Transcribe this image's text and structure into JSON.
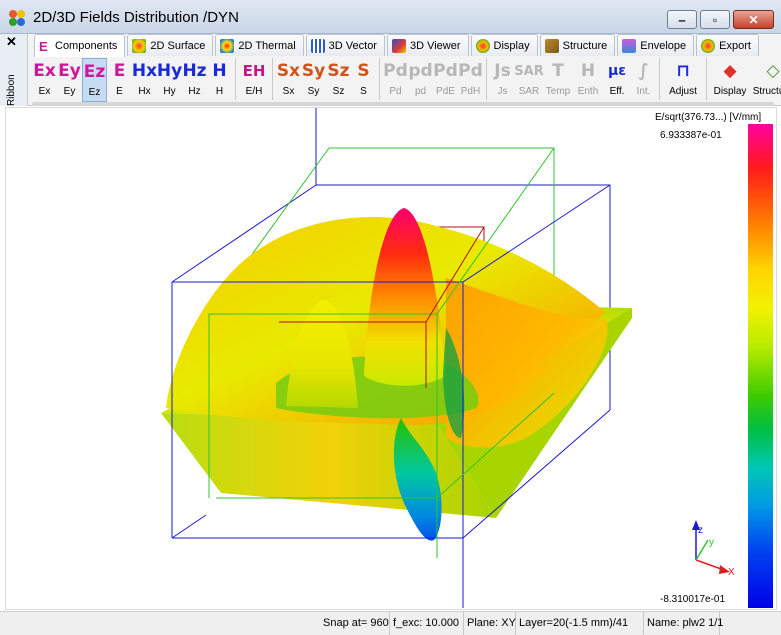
{
  "window": {
    "title": "2D/3D Fields Distribution /DYN"
  },
  "ribbon": {
    "label": "Ribbon",
    "close": "✕"
  },
  "tabs": [
    {
      "label": "Components",
      "icon": "components-icon"
    },
    {
      "label": "2D Surface",
      "icon": "surface-icon"
    },
    {
      "label": "2D Thermal",
      "icon": "thermal-icon"
    },
    {
      "label": "3D Vector",
      "icon": "vector-icon"
    },
    {
      "label": "3D Viewer",
      "icon": "viewer-icon"
    },
    {
      "label": "Display",
      "icon": "display-icon"
    },
    {
      "label": "Structure",
      "icon": "structure-icon"
    },
    {
      "label": "Envelope",
      "icon": "envelope-icon"
    },
    {
      "label": "Export",
      "icon": "export-icon"
    }
  ],
  "tools": [
    {
      "glyph": "Ex",
      "label": "Ex"
    },
    {
      "glyph": "Ey",
      "label": "Ey"
    },
    {
      "glyph": "Ez",
      "label": "Ez"
    },
    {
      "glyph": "E",
      "label": "E"
    },
    {
      "glyph": "Hx",
      "label": "Hx"
    },
    {
      "glyph": "Hy",
      "label": "Hy"
    },
    {
      "glyph": "Hz",
      "label": "Hz"
    },
    {
      "glyph": "H",
      "label": "H"
    },
    {
      "glyph": "EH",
      "label": "E/H"
    },
    {
      "glyph": "Sx",
      "label": "Sx"
    },
    {
      "glyph": "Sy",
      "label": "Sy"
    },
    {
      "glyph": "Sz",
      "label": "Sz"
    },
    {
      "glyph": "S",
      "label": "S"
    },
    {
      "glyph": "Pd",
      "label": "Pd"
    },
    {
      "glyph": "pd",
      "label": "pd"
    },
    {
      "glyph": "Pd",
      "label": "PdE"
    },
    {
      "glyph": "Pd",
      "label": "PdH"
    },
    {
      "glyph": "Js",
      "label": "Js"
    },
    {
      "glyph": "SAR",
      "label": "SAR"
    },
    {
      "glyph": "T",
      "label": "Temp"
    },
    {
      "glyph": "H",
      "label": "Enth"
    },
    {
      "glyph": "με",
      "label": "Eff."
    },
    {
      "glyph": "∫",
      "label": "Int."
    },
    {
      "glyph": "⊓",
      "label": "Adjust"
    },
    {
      "glyph": "◆",
      "label": "Display"
    },
    {
      "glyph": "◇",
      "label": "Structure"
    }
  ],
  "selected_tool": "Ez",
  "colorbar": {
    "title": "E/sqrt(376.73...) [V/mm]",
    "max": "6.933387e-01",
    "min": "-8.310017e-01"
  },
  "axes_triad": {
    "x": "X",
    "y": "y",
    "z": "z"
  },
  "status": {
    "snap": "Snap at= 960",
    "fexc": "f_exc: 10.000",
    "plane": "Plane: XY",
    "layer": "Layer=20(-1.5 mm)/41",
    "name": "Name: plw2 1/1"
  },
  "colors": {
    "box_outer": "#1a1ad6",
    "box_middle": "#2ec52e",
    "box_inner": "#b01010",
    "surface_high": "#ff0060",
    "surface_low": "#0070d8",
    "surface_mid": "#e0e800"
  }
}
